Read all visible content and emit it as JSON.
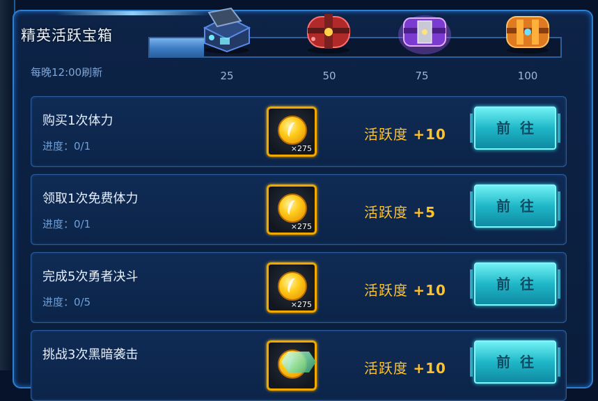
{
  "panel": {
    "title": "精英活跃宝箱",
    "refresh_note": "每晚12:00刷新"
  },
  "activity_progress": {
    "fill_fraction": 0.0,
    "milestones": [
      {
        "value": "25",
        "chest": "blue-chest-icon",
        "color": "#3b6fd8"
      },
      {
        "value": "50",
        "chest": "red-chest-icon",
        "color": "#d83a3a"
      },
      {
        "value": "75",
        "chest": "purple-chest-icon",
        "color": "#9a4af0"
      },
      {
        "value": "100",
        "chest": "orange-chest-icon",
        "color": "#f08a20"
      }
    ]
  },
  "tasks": [
    {
      "name": "购买1次体力",
      "progress": "进度：0/1",
      "reward_icon": "gold-coin-icon",
      "reward_qty": "×275",
      "activity_label": "活跃度",
      "activity_points": "+10",
      "button": "前往"
    },
    {
      "name": "领取1次免费体力",
      "progress": "进度：0/1",
      "reward_icon": "gold-coin-icon",
      "reward_qty": "×275",
      "activity_label": "活跃度",
      "activity_points": "+5",
      "button": "前往"
    },
    {
      "name": "完成5次勇者决斗",
      "progress": "进度：0/5",
      "reward_icon": "gold-coin-icon",
      "reward_qty": "×275",
      "activity_label": "活跃度",
      "activity_points": "+10",
      "button": "前往"
    },
    {
      "name": "挑战3次黑暗袭击",
      "progress": "",
      "reward_icon": "gold-coin-icon",
      "reward_qty": "",
      "activity_label": "活跃度",
      "activity_points": "+10",
      "button": "前往"
    }
  ]
}
